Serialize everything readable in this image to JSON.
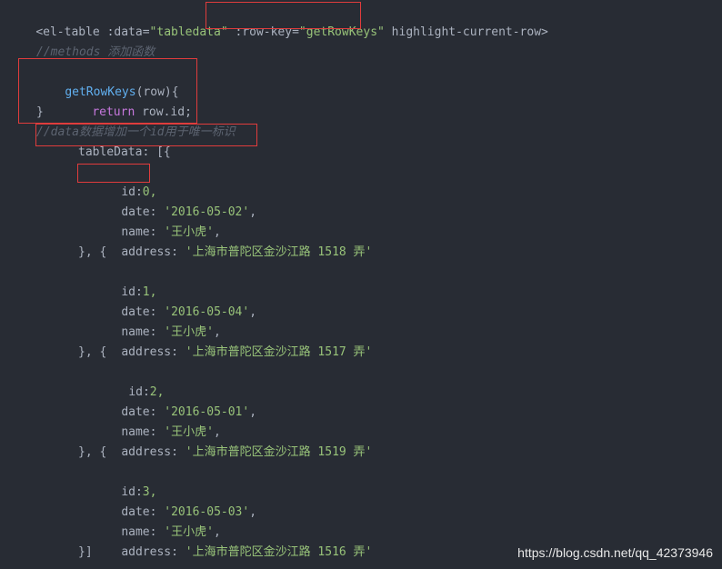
{
  "colors": {
    "background": "#282c34",
    "plain": "#abb2bf",
    "string": "#98c379",
    "function": "#61afef",
    "keyword": "#c678dd",
    "comment": "#5c6370",
    "highlight_box": "#e03c3c"
  },
  "code": {
    "line1": {
      "open": "<el-table :data=",
      "data_value": "\"tabledata\"",
      "rowkey_attr": " :row-key=",
      "rowkey_value": "\"getRowKeys\"",
      "rest": " highlight-current-row>"
    },
    "comment_methods": "//methods 添加函数",
    "fn_name": "getRowKeys",
    "fn_params": "(row){",
    "return_kw": "return",
    "return_expr": " row.id;",
    "fn_close": "}",
    "comment_data": "//data数据增加一个id用于唯一标识",
    "tabledata_open": "tableData: [{",
    "rows": [
      {
        "id_label": "id:",
        "id_value": "0,",
        "date_label": "date: ",
        "date_value": "'2016-05-02'",
        "name_label": "name: ",
        "name_value": "'王小虎'",
        "address_label": "address: ",
        "address_value": "'上海市普陀区金沙江路 1518 弄'"
      },
      {
        "id_label": "id:",
        "id_value": "1,",
        "date_label": "date: ",
        "date_value": "'2016-05-04'",
        "name_label": "name: ",
        "name_value": "'王小虎'",
        "address_label": "address: ",
        "address_value": "'上海市普陀区金沙江路 1517 弄'"
      },
      {
        "id_label": "id:",
        "id_value": "2,",
        "date_label": "date: ",
        "date_value": "'2016-05-01'",
        "name_label": "name: ",
        "name_value": "'王小虎'",
        "address_label": "address: ",
        "address_value": "'上海市普陀区金沙江路 1519 弄'"
      },
      {
        "id_label": "id:",
        "id_value": "3,",
        "date_label": "date: ",
        "date_value": "'2016-05-03'",
        "name_label": "name: ",
        "name_value": "'王小虎'",
        "address_label": "address: ",
        "address_value": "'上海市普陀区金沙江路 1516 弄'"
      }
    ],
    "row_sep": "}, {",
    "tabledata_close": "}]",
    "comma": ","
  },
  "watermark": "https://blog.csdn.net/qq_42373946"
}
